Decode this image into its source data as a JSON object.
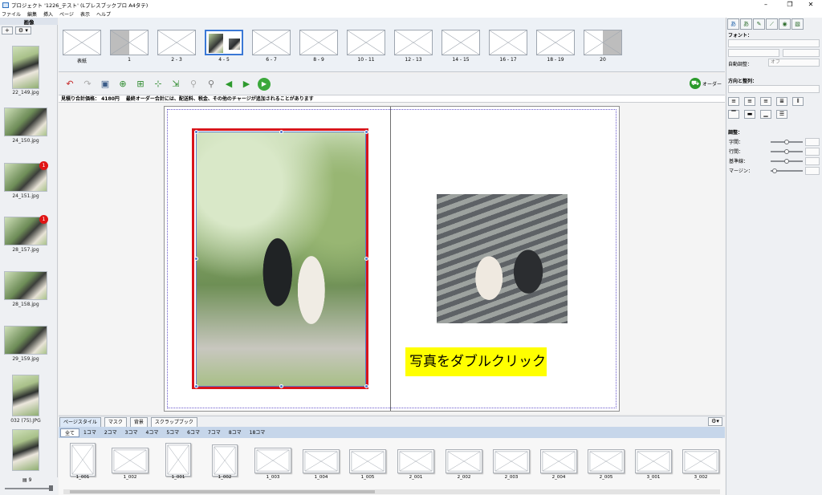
{
  "window": {
    "title": "プロジェクト '1226_テスト' (Lプレスブックプロ A4タテ)"
  },
  "menu": [
    "ファイル",
    "編集",
    "挿入",
    "ページ",
    "表示",
    "ヘルプ"
  ],
  "left_panel": {
    "header": "画像",
    "add_btn": "+",
    "settings_btn": "⚙ ▾",
    "photos": [
      {
        "name": "22_149.jpg",
        "badge": ""
      },
      {
        "name": "24_150.jpg",
        "badge": ""
      },
      {
        "name": "24_151.jpg",
        "badge": "1"
      },
      {
        "name": "28_157.jpg",
        "badge": "1"
      },
      {
        "name": "28_158.jpg",
        "badge": ""
      },
      {
        "name": "29_159.jpg",
        "badge": ""
      },
      {
        "name": "032 (75).JPG",
        "badge": ""
      },
      {
        "name": "",
        "badge": ""
      }
    ],
    "count": "9"
  },
  "spread_strip": [
    "表紙",
    "1",
    "2 - 3",
    "4 - 5",
    "6 - 7",
    "8 - 9",
    "10 - 11",
    "12 - 13",
    "14 - 15",
    "16 - 17",
    "18 - 19",
    "20"
  ],
  "toolbar": {
    "order_label": "オーダー",
    "estimate": "見積り合計価格： 4180円　 最終オーダー合計には、配送料、税金、その他のチャージが追加されることがあります"
  },
  "canvas": {
    "hint_text": "写真をダブルクリック"
  },
  "bottom_tabs": [
    "ページスタイル",
    "マスク",
    "背景",
    "スクラップブック"
  ],
  "bottom_subtabs": [
    "全て",
    "1コマ",
    "2コマ",
    "3コマ",
    "4コマ",
    "5コマ",
    "6コマ",
    "7コマ",
    "8コマ",
    "18コマ"
  ],
  "templates": [
    "1_001",
    "1_002",
    "1_001",
    "1_002",
    "1_003",
    "1_004",
    "1_005",
    "2_001",
    "2_002",
    "2_003",
    "2_004",
    "2_005",
    "3_001",
    "3_002"
  ],
  "right_panel": {
    "font_label": "フォント：",
    "auto_adjust_label": "自動調整：",
    "auto_adjust_value": "オフ",
    "direction_label": "方向と整列：",
    "adjust_label": "調整：",
    "adjust_items": [
      "字間：",
      "行間：",
      "基準線：",
      "マージン："
    ]
  }
}
